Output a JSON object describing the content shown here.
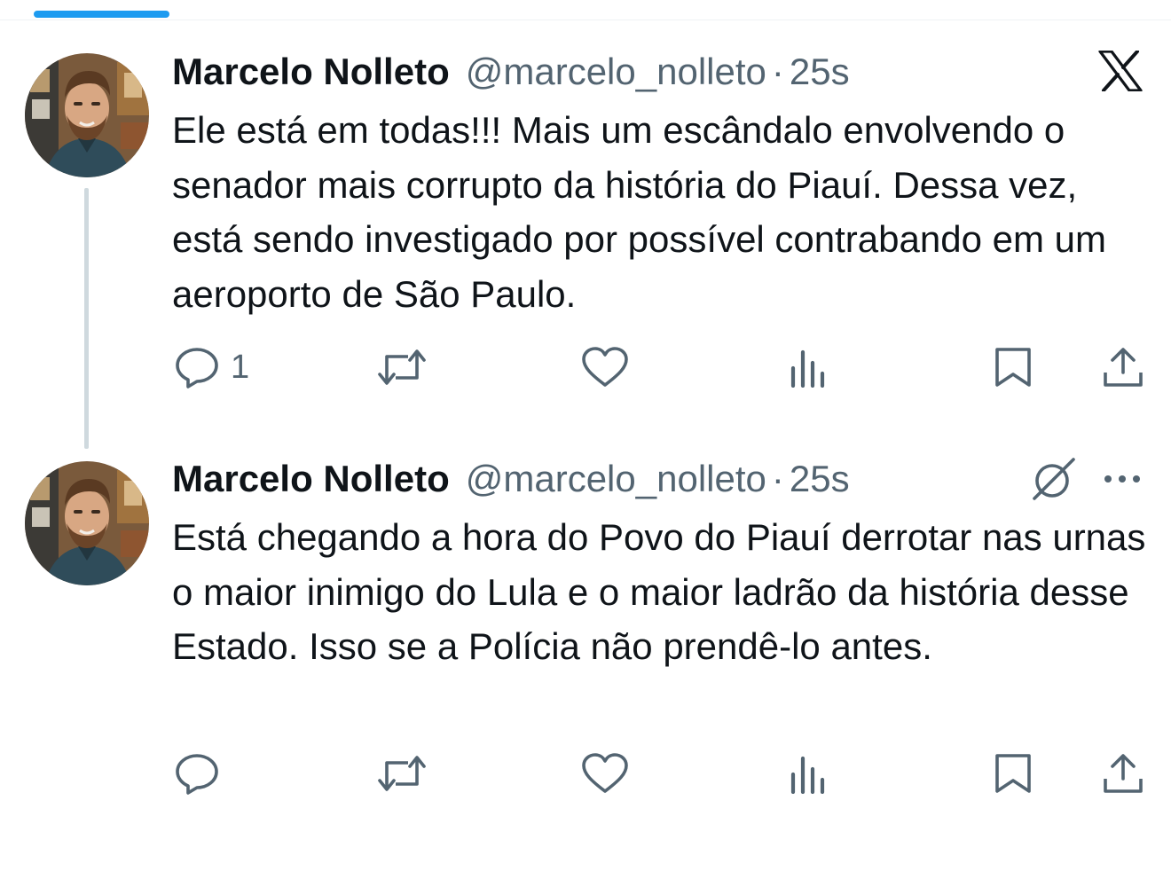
{
  "tweets": [
    {
      "name": "Marcelo Nolleto",
      "handle": "@marcelo_nolleto",
      "separator": "·",
      "time": "25s",
      "text": "Ele está em todas!!! Mais um escândalo envolvendo o senador mais corrupto da história do Piauí. Dessa vez, está sendo investigado por possível contrabando em um aeroporto de São Paulo.",
      "reply_count": "1",
      "corner_icon": "x-logo-icon"
    },
    {
      "name": "Marcelo Nolleto",
      "handle": "@marcelo_nolleto",
      "separator": "·",
      "time": "25s",
      "text": "Está chegando a hora do Povo do Piauí derrotar nas urnas o maior inimigo do Lula e o maior ladrão da história desse Estado. Isso se a Polícia não prendê-lo antes.",
      "reply_count": "",
      "corner_icon": "grok-icon"
    }
  ],
  "icons": [
    "reply-icon",
    "retweet-icon",
    "like-icon",
    "views-icon",
    "bookmark-icon",
    "share-icon",
    "more-icon"
  ],
  "colors": {
    "text": "#0f1419",
    "muted": "#536471",
    "accent": "#1d9bf0",
    "thread_line": "#cfd9de"
  }
}
